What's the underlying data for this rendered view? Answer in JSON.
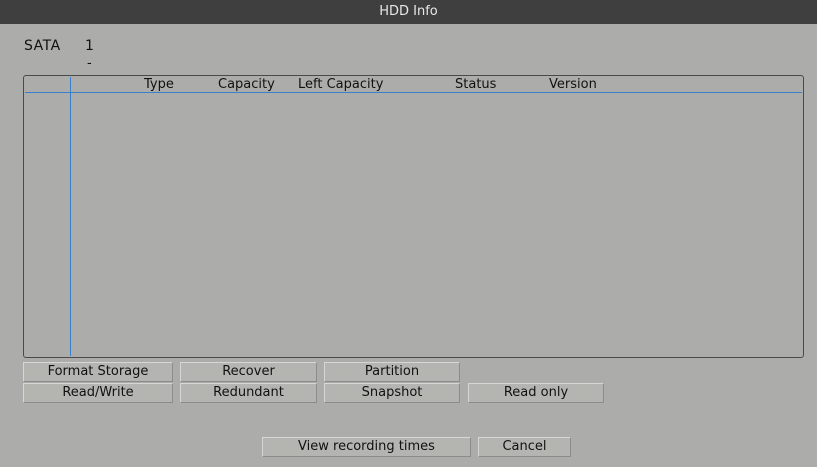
{
  "window": {
    "title": "HDD Info"
  },
  "disk": {
    "label": "SATA",
    "number": "1",
    "sub": "-"
  },
  "table": {
    "headers": [
      "Type",
      "Capacity",
      "Left Capacity",
      "Status",
      "Version"
    ]
  },
  "buttons": {
    "format_storage": "Format Storage",
    "recover": "Recover",
    "partition": "Partition",
    "read_write": "Read/Write",
    "redundant": "Redundant",
    "snapshot": "Snapshot",
    "read_only": "Read only",
    "view_recording_times": "View recording times",
    "cancel": "Cancel"
  },
  "colors": {
    "titlebar": "#3e3f3e",
    "background": "#acadaa",
    "grid_line": "#3a7fc8"
  }
}
